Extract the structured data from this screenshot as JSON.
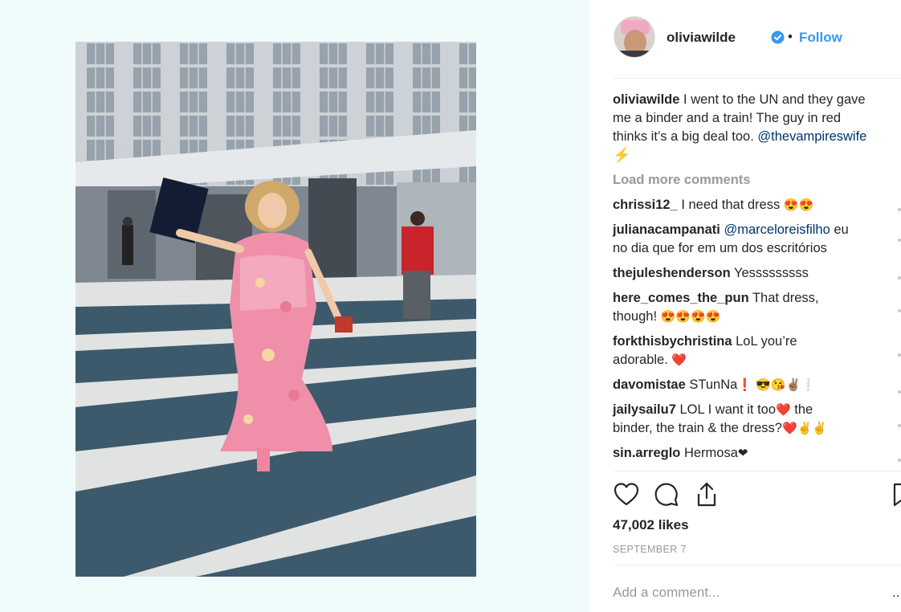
{
  "post": {
    "username": "oliviawilde",
    "follow_label": "Follow",
    "separator": "•",
    "caption_user": "oliviawilde",
    "caption_line1": " I went to the UN and they gave",
    "caption_line2": "me a binder and a train! The guy in red",
    "caption_line3": "thinks it’s a big deal too. ",
    "caption_mention": "@thevampireswife",
    "caption_emoji": "⚡",
    "load_more": "Load more comments",
    "likes": "47,002 likes",
    "date": "SEPTEMBER 7",
    "add_comment_placeholder": "Add a comment...",
    "more_label": "..."
  },
  "comments": [
    {
      "user": "chrissi12_",
      "text": " I need that dress ",
      "emoji": "😍😍"
    },
    {
      "user": "julianacampanati",
      "mention": " @marceloreisfilho",
      "text": " eu",
      "line2": "no dia que for em um dos escritórios"
    },
    {
      "user": "thejuleshenderson",
      "text": " Yesssssssss"
    },
    {
      "user": "here_comes_the_pun",
      "text": " That dress,",
      "line2": "though! ",
      "emoji": "😍😍😍😍"
    },
    {
      "user": "forkthisbychristina",
      "text": " LoL you’re",
      "line2": "adorable. ",
      "emoji": "❤️"
    },
    {
      "user": "davomistae",
      "text": " STunNa",
      "emoji": "❗ 😎😘✌🏽❕"
    },
    {
      "user": "jailysailu7",
      "text": " LOL I want it too",
      "heart": "❤️",
      "text2": " the",
      "line2": "binder, the train & the dress?",
      "emoji": "❤️✌️✌️"
    },
    {
      "user": "sin.arreglo",
      "text": " Hermosa",
      "emoji": "❤"
    }
  ],
  "icons": [
    "heart-icon",
    "comment-icon",
    "share-icon",
    "bookmark-icon",
    "verified-badge-icon"
  ],
  "colors": {
    "link": "#3897f0",
    "mention": "#003569",
    "muted": "#999999",
    "left_background": "#f0fbfb"
  }
}
